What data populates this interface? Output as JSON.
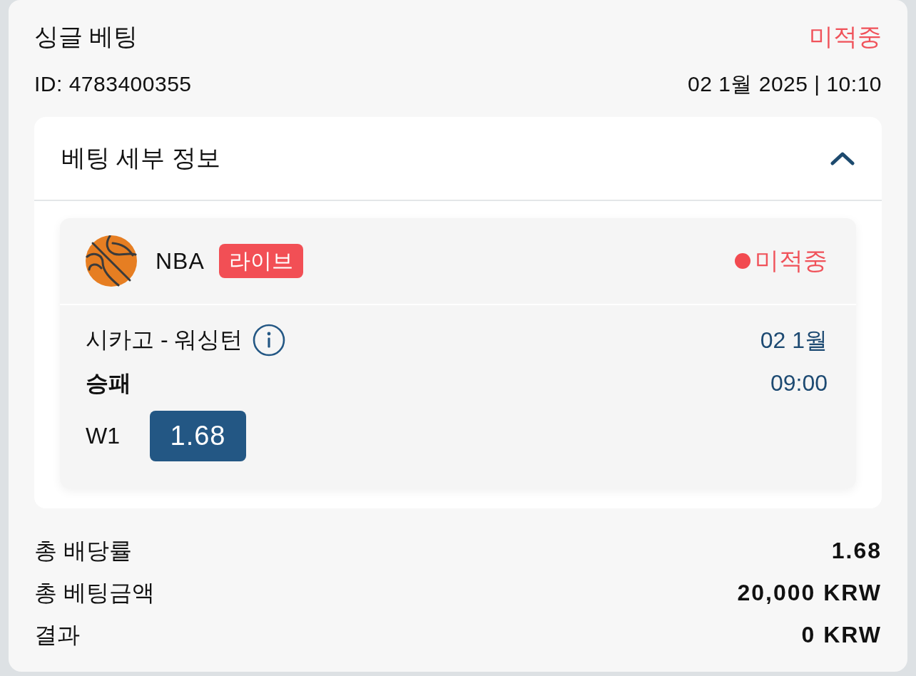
{
  "bet": {
    "title": "싱글 베팅",
    "status": "미적중",
    "id": "ID: 4783400355",
    "datetime": "02 1월 2025 | 10:10"
  },
  "details": {
    "title": "베팅 세부 정보",
    "expanded": true,
    "events": [
      {
        "league": "NBA",
        "badge": "라이브",
        "status": "미적중",
        "match": "시카고 - 워싱턴",
        "date": "02 1월",
        "market": "승패",
        "time": "09:00",
        "selection": "W1",
        "odds": "1.68"
      }
    ]
  },
  "summary": [
    {
      "label": "총 배당률",
      "value": "1.68"
    },
    {
      "label": "총 베팅금액",
      "value": "20,000 KRW"
    },
    {
      "label": "결과",
      "value": "0 KRW"
    }
  ]
}
